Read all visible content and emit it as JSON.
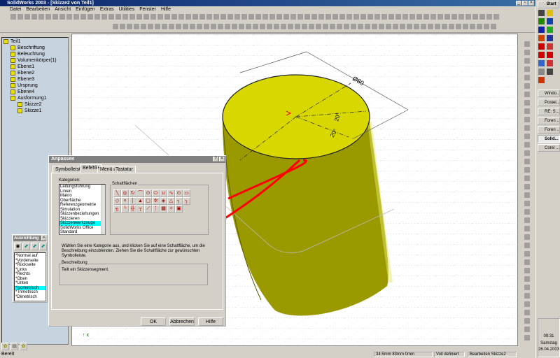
{
  "window": {
    "title": "SolidWorks 2003 - [Skizze2 von Teil1]"
  },
  "menu": [
    "Datei",
    "Bearbeiten",
    "Ansicht",
    "Einfügen",
    "Extras",
    "Utilities",
    "Fenster",
    "Hilfe"
  ],
  "tree": {
    "root": "Teil1",
    "items": [
      "Beschriftung",
      "Beleuchtung",
      "Volumenkörper(1)",
      "Ebene1",
      "Ebene2",
      "Ebene3",
      "Ursprung",
      "Ebene4",
      "Ausformung1",
      "Skizze2",
      "Skizze1"
    ]
  },
  "model": {
    "diameter_label": "Ø80",
    "angle1": "20°",
    "angle2": "20°",
    "top_color": "#d8d800",
    "side_color": "#9a9a00"
  },
  "dialog": {
    "title": "Anpassen",
    "tabs": [
      "Symbolleisten",
      "Befehle",
      "Menüs",
      "Tastatur"
    ],
    "active_tab": "Befehle",
    "categories_label": "Kategorien:",
    "categories": [
      "Leitungsführung",
      "Linien",
      "Makro",
      "Oberfläche",
      "Referenzgeometrie",
      "Simulation",
      "Skizzenbeziehungen",
      "Skizzieren",
      "Skizzenwerkzeuge",
      "SolidWorks Office",
      "Standard"
    ],
    "selected_category": "Skizzenwerkzeuge",
    "buttons_label": "Schaltflächen",
    "instructions": "Wählen Sie eine Kategorie aus, und klicken Sie auf eine Schaltfläche, um die Beschreibung einzublenden. Ziehen Sie die Schaltfläche zur gewünschten Symbolleiste.",
    "description_label": "Beschreibung",
    "description": "Teilt ein Skizzensegment.",
    "ok": "OK",
    "cancel": "Abbrechen",
    "help": "Hilfe"
  },
  "orientation": {
    "title": "Ausrichtung",
    "items": [
      "*Normal auf",
      "*Vorderseite",
      "*Rückseite",
      "*Links",
      "*Rechts",
      "*Oben",
      "*Unten",
      "*Isometrisch",
      "*Trimetrisch",
      "*Dimetrisch"
    ],
    "selected": "*Isometrisch"
  },
  "status": {
    "left": "Bereit",
    "coords": "34.5mm   83mm   0mm",
    "state": "Voll definiert",
    "mode": "Bearbeiten Skizze2"
  },
  "taskbar": {
    "start": "Start",
    "tasks": [
      "Windo...",
      "Postei...",
      "RE: S...",
      "Foren ...",
      "Foren ...",
      "Solid...",
      "Corel ..."
    ],
    "active": "Solid...",
    "time": "09:31",
    "day": "Samstag",
    "date": "26.04.2003"
  },
  "annotation_color": "#ff0000"
}
